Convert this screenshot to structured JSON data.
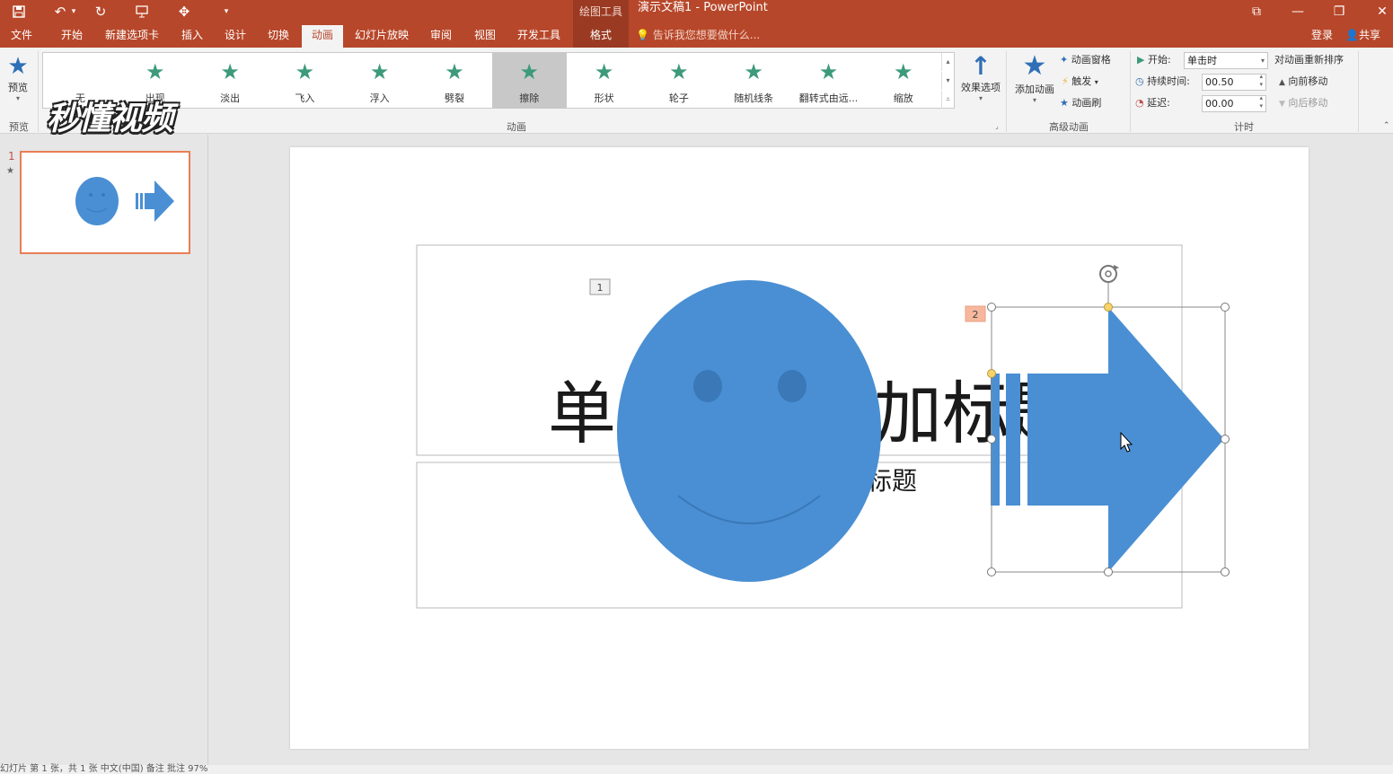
{
  "app": {
    "window_title": "演示文稿1 - PowerPoint",
    "context_label": "绘图工具",
    "window_buttons": [
      "⧉",
      "—",
      "❐",
      "✕"
    ]
  },
  "tabs": [
    "文件",
    "开始",
    "新建选项卡",
    "插入",
    "设计",
    "切换",
    "动画",
    "幻灯片放映",
    "审阅",
    "视图",
    "开发工具",
    "格式"
  ],
  "active_tab": "动画",
  "tell_me": "告诉我您想要做什么...",
  "signin": "登录",
  "share": "共享",
  "ribbon": {
    "preview_label": "预览",
    "preview_group": "预览",
    "animation_group": "动画",
    "animations": [
      {
        "label": "无",
        "icon": "none-icon"
      },
      {
        "label": "出现",
        "icon": "appear-star-icon"
      },
      {
        "label": "淡出",
        "icon": "fade-star-icon"
      },
      {
        "label": "飞入",
        "icon": "fly-in-star-icon"
      },
      {
        "label": "浮入",
        "icon": "float-in-star-icon"
      },
      {
        "label": "劈裂",
        "icon": "split-star-icon"
      },
      {
        "label": "擦除",
        "icon": "wipe-star-icon"
      },
      {
        "label": "形状",
        "icon": "shape-star-icon"
      },
      {
        "label": "轮子",
        "icon": "wheel-star-icon"
      },
      {
        "label": "随机线条",
        "icon": "random-bars-star-icon"
      },
      {
        "label": "翻转式由远...",
        "icon": "grow-turn-star-icon"
      },
      {
        "label": "缩放",
        "icon": "zoom-star-icon"
      }
    ],
    "selected_animation": "擦除",
    "effect_options": "效果选项",
    "add_animation": "添加动画",
    "animation_pane": "动画窗格",
    "trigger": "触发",
    "animation_painter": "动画刷",
    "advanced_group": "高级动画",
    "start_label": "开始:",
    "start_value": "单击时",
    "duration_label": "持续时间:",
    "duration_value": "00.50",
    "delay_label": "延迟:",
    "delay_value": "00.00",
    "timing_group": "计时",
    "reorder_title": "对动画重新排序",
    "move_earlier": "向前移动",
    "move_later": "向后移动"
  },
  "thumbnails": {
    "slide_number": "1",
    "star": "★"
  },
  "slide": {
    "title_visible_left": "单",
    "title_visible_right": "加标题",
    "subtitle_visible": "标题",
    "anim_tag_1": "1",
    "anim_tag_2": "2"
  },
  "watermark": "秒懂视频",
  "status": "幻灯片 第 1 张，共 1 张    中文(中国)                                                                                                                                                 备注    批注                                                                    97%",
  "colors": {
    "accent": "#b7472a",
    "shape_blue": "#4a8fd3",
    "selection_tag": "#f6b79d"
  }
}
